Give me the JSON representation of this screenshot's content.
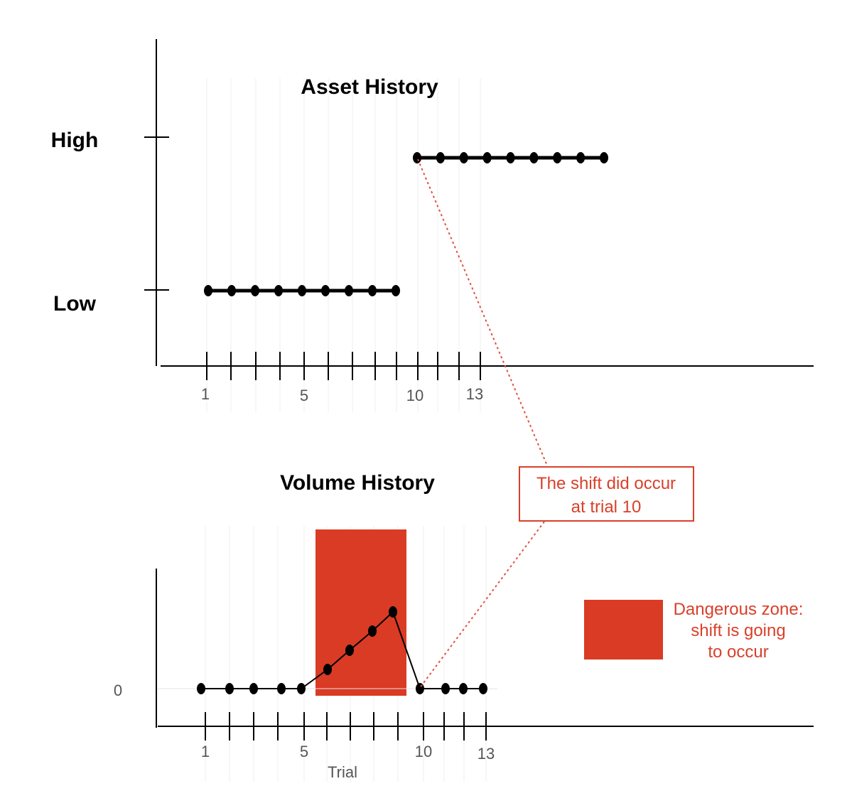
{
  "asset_chart": {
    "title": "Asset History",
    "y_levels": [
      "Low",
      "High"
    ],
    "x_tick_labels": [
      "1",
      "5",
      "10",
      "13"
    ],
    "values": [
      "Low",
      "Low",
      "Low",
      "Low",
      "Low",
      "Low",
      "Low",
      "Low",
      "Low",
      "High",
      "High",
      "High",
      "High",
      "High",
      "High",
      "High",
      "High",
      "High"
    ]
  },
  "volume_chart": {
    "title": "Volume History",
    "y_tick_label": "0",
    "x_label": "Trial",
    "x_tick_labels": [
      "1",
      "5",
      "10",
      "13"
    ],
    "values": [
      0,
      0,
      0,
      0,
      0,
      1,
      2,
      3,
      4,
      0,
      0,
      0,
      0
    ],
    "danger_zone_trials": [
      5.6,
      9.6
    ]
  },
  "annotations": {
    "shift_line1": "The shift did occur",
    "shift_line2": "at trial 10",
    "legend_line1": "Dangerous zone:",
    "legend_line2": "shift is going",
    "legend_line3": "to occur"
  },
  "colors": {
    "danger": "#d93b24",
    "annotation": "#d9402a",
    "line": "#000000"
  }
}
